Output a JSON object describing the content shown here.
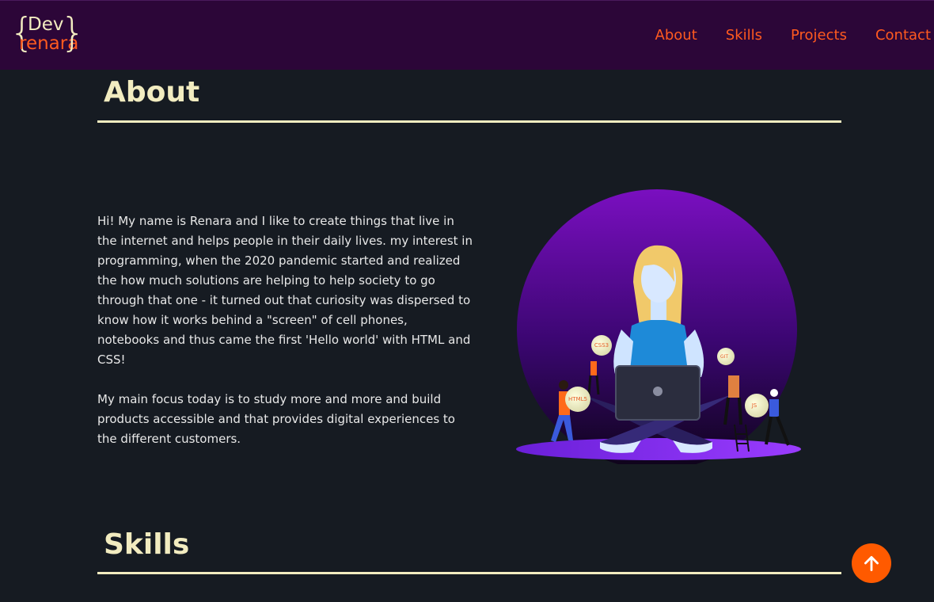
{
  "header": {
    "logo_top": "Dev",
    "logo_bottom": "renara",
    "logo_brace_left": "{",
    "logo_brace_right": "}",
    "nav": [
      {
        "label": "About"
      },
      {
        "label": "Skills"
      },
      {
        "label": "Projects"
      },
      {
        "label": "Contact"
      }
    ]
  },
  "about": {
    "title": "About",
    "paragraph_1": "Hi! My name is Renara and I like to create things that live in the internet and helps people in their daily lives. my interest in programming, when the 2020 pandemic started and realized the how much solutions are helping to help society to go through that one - it turned out that curiosity was dispersed to know how it works behind a \"screen\" of cell phones, notebooks and thus came the first 'Hello world' with HTML and CSS!",
    "paragraph_2": "My main focus today is to study more and more and build products accessible and that provides digital experiences to the different customers.",
    "illustration_badges": [
      "CSS3",
      "GIT",
      "HTML5",
      "JS"
    ]
  },
  "skills": {
    "title": "Skills"
  },
  "scroll_top_icon": "arrow-up-icon",
  "colors": {
    "background": "#161b22",
    "header": "#2c0638",
    "accent": "#ff5a1f",
    "cream": "#f2ecc0"
  }
}
